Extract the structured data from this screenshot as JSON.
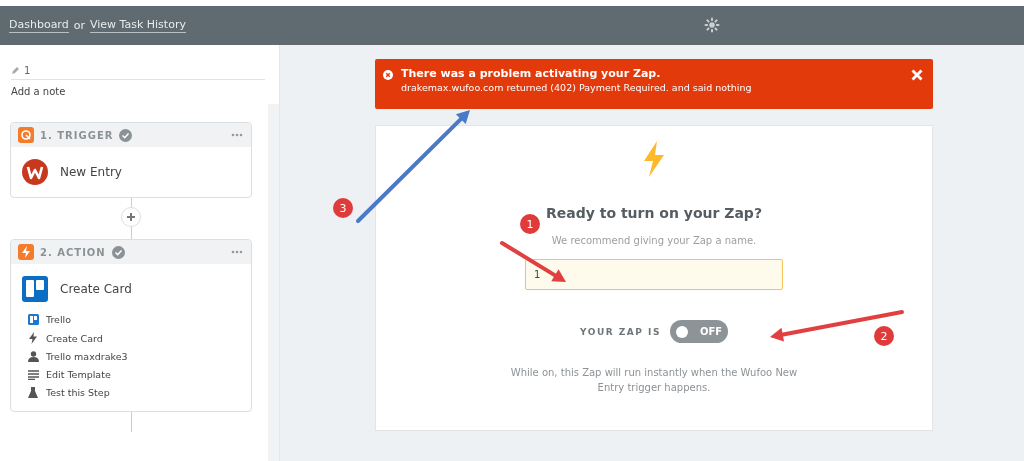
{
  "header": {
    "links": [
      {
        "label": "Dashboard"
      },
      {
        "label": "View Task History"
      }
    ],
    "separator": "or"
  },
  "sidebar": {
    "zap_name": "1",
    "note_link": "Add a note",
    "steps": [
      {
        "kind": "trigger",
        "title": "1. TRIGGER",
        "complete": true,
        "app": "New Entry"
      },
      {
        "kind": "action",
        "title": "2. ACTION",
        "complete": true,
        "app": "Create Card",
        "details": [
          {
            "kind": "app",
            "label": "Trello"
          },
          {
            "kind": "event",
            "label": "Create Card"
          },
          {
            "kind": "account",
            "label": "Trello maxdrake3"
          },
          {
            "kind": "template",
            "label": "Edit Template"
          },
          {
            "kind": "test",
            "label": "Test this Step"
          }
        ]
      }
    ]
  },
  "alert": {
    "title": "There was a problem activating your Zap.",
    "message": "drakemax.wufoo.com returned (402) Payment Required. and said nothing"
  },
  "panel": {
    "heading": "Ready to turn on your Zap?",
    "hint": "We recommend giving your Zap a name.",
    "name_value": "1",
    "toggle_label": "YOUR ZAP IS",
    "toggle": {
      "on": false,
      "label": "OFF"
    },
    "note": "While on, this Zap will run instantly when the Wufoo New Entry trigger happens."
  },
  "annotations": [
    {
      "label": "1"
    },
    {
      "label": "2"
    },
    {
      "label": "3"
    }
  ]
}
